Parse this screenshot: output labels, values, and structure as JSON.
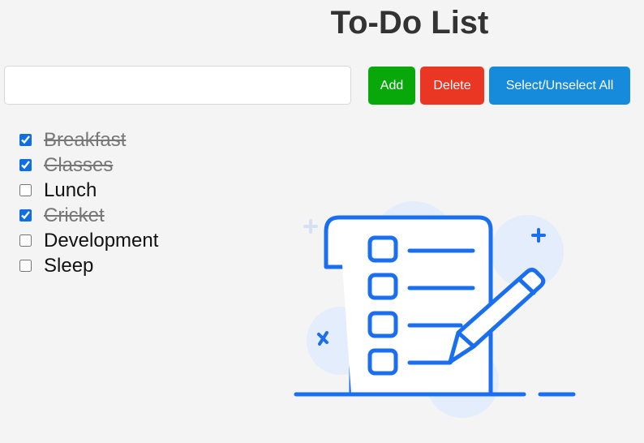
{
  "header": {
    "title": "To-Do List"
  },
  "input": {
    "value": "",
    "placeholder": ""
  },
  "buttons": {
    "add": "Add",
    "delete": "Delete",
    "select_all": "Select/Unselect All"
  },
  "colors": {
    "add": "#08a80b",
    "delete": "#ea3724",
    "select_all": "#168bdb",
    "illustration": "#1a6ef0"
  },
  "tasks": [
    {
      "label": "Breakfast",
      "checked": true
    },
    {
      "label": "Classes",
      "checked": true
    },
    {
      "label": "Lunch",
      "checked": false
    },
    {
      "label": "Cricket",
      "checked": true
    },
    {
      "label": "Development",
      "checked": false
    },
    {
      "label": "Sleep",
      "checked": false
    }
  ]
}
